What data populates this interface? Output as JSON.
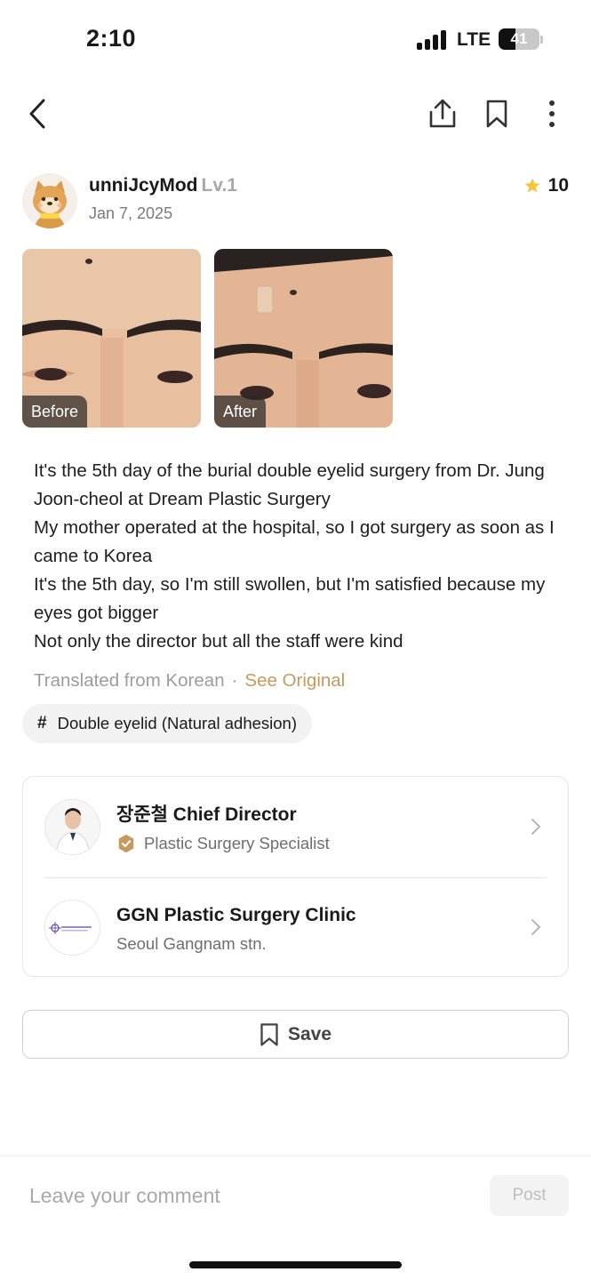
{
  "status_bar": {
    "time": "2:10",
    "network": "LTE",
    "battery_percent": "41",
    "battery_level": 0.41
  },
  "nav": {
    "back_icon": "chevron-left-icon",
    "share_icon": "share-icon",
    "bookmark_icon": "bookmark-icon",
    "more_icon": "more-vertical-icon"
  },
  "post": {
    "author": "unniJcyMod",
    "level": "Lv.1",
    "date": "Jan 7, 2025",
    "rating": "10",
    "star_color": "#F5C53F",
    "photos": [
      {
        "label": "Before"
      },
      {
        "label": "After"
      }
    ],
    "body_lines": [
      "It's the 5th day of the burial double eyelid surgery from Dr. Jung Joon-cheol at Dream Plastic Surgery",
      "My mother operated at the hospital, so I got surgery as soon as I came to Korea",
      "It's the 5th day, so I'm still swollen, but I'm satisfied because my eyes got bigger",
      "Not only the director but all the staff were kind"
    ],
    "translated_label": "Translated from Korean",
    "separator": "·",
    "see_original": "See Original",
    "accent_color": "#C59A5E",
    "tag_hash": "#",
    "tag": "Double eyelid (Natural adhesion)"
  },
  "doctor_card": {
    "doctor": {
      "name": "장준철 Chief Director",
      "specialty": "Plastic Surgery Specialist",
      "badge_color": "#C59A5E"
    },
    "clinic": {
      "name": "GGN Plastic Surgery Clinic",
      "location": "Seoul Gangnam stn."
    }
  },
  "save_button": {
    "label": "Save"
  },
  "comment": {
    "placeholder": "Leave your comment",
    "post_label": "Post"
  }
}
